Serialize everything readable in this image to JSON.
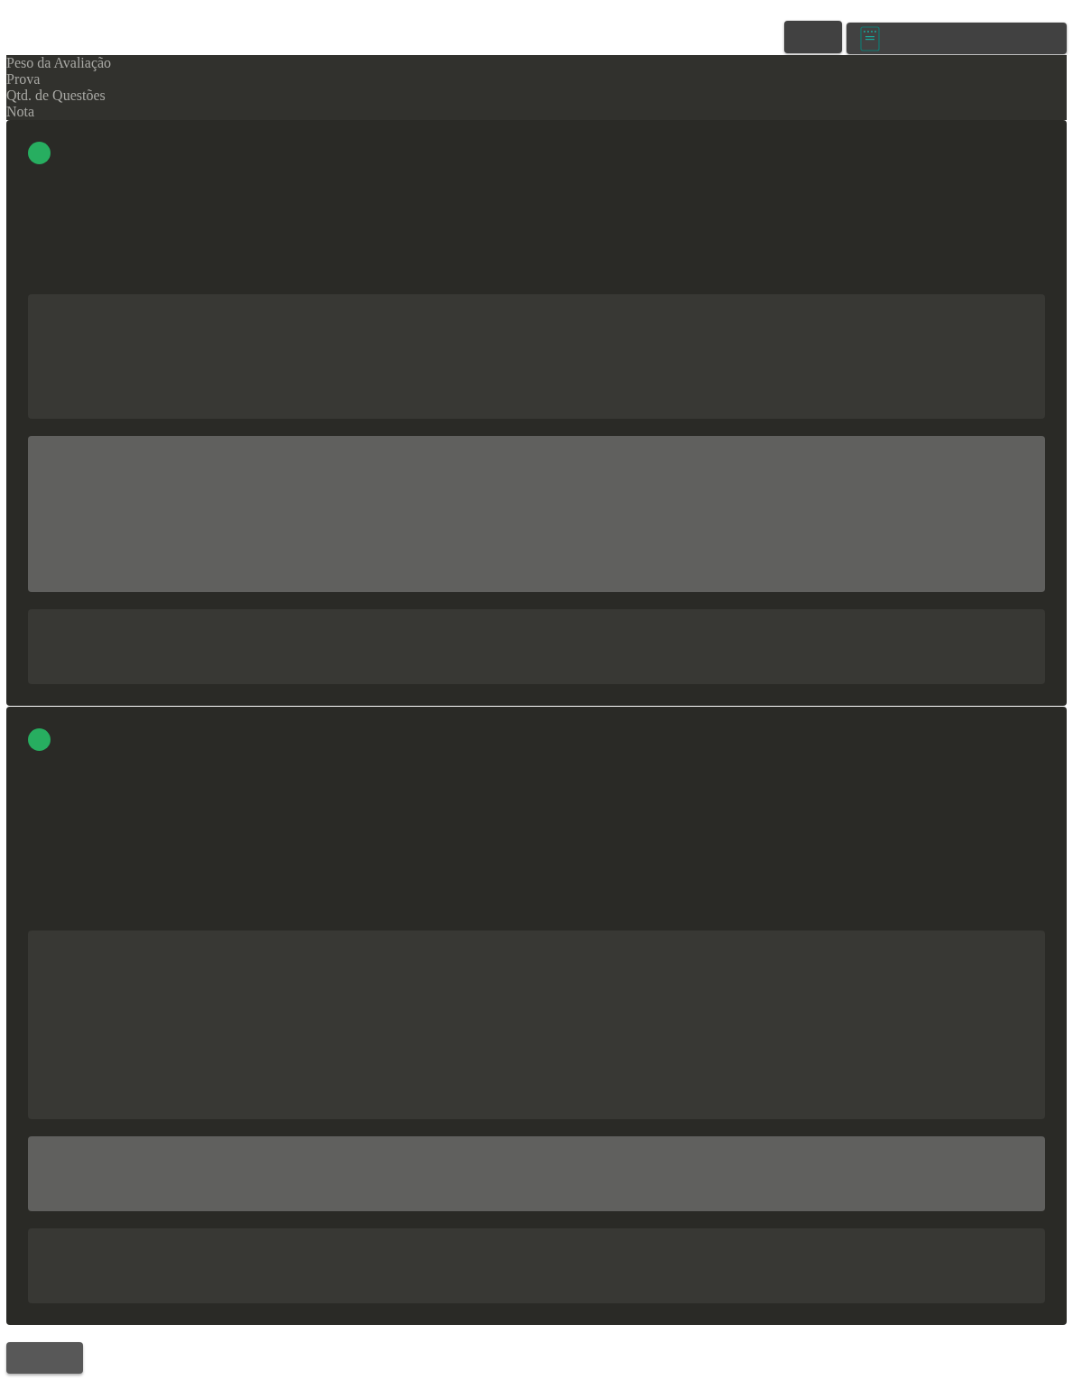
{
  "header_labels": [
    "Peso da Avaliação",
    "Prova",
    "Qtd. de Questões",
    "Nota"
  ],
  "cards": [
    {
      "color": "#27ae60",
      "blocks": [
        {
          "selected": false
        },
        {
          "selected": true
        },
        {
          "selected": false
        }
      ]
    },
    {
      "color": "#27ae60",
      "blocks": [
        {
          "selected": false
        },
        {
          "selected": true
        },
        {
          "selected": false
        }
      ]
    }
  ]
}
